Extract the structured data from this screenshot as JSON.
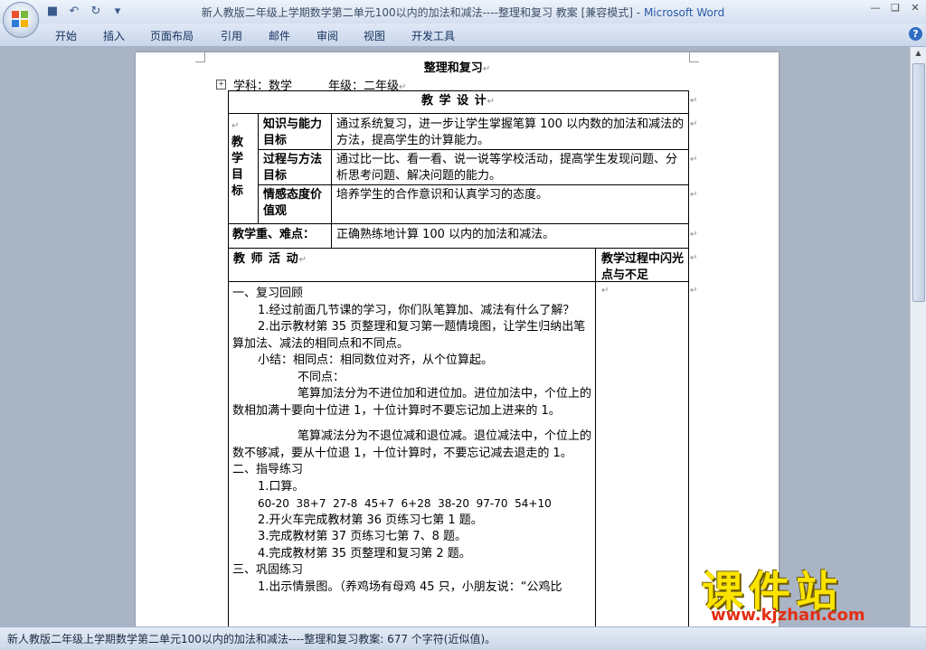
{
  "window": {
    "title": "新人教版二年级上学期数学第二单元100以内的加法和减法----整理和复习 教案 [兼容模式]",
    "app_name": "Microsoft Word",
    "title_sep": " - "
  },
  "ribbon": {
    "tabs": [
      "开始",
      "插入",
      "页面布局",
      "引用",
      "邮件",
      "审阅",
      "视图",
      "开发工具"
    ]
  },
  "document": {
    "heading": "整理和复习",
    "subject": "学科：数学",
    "grade": "年级：二年级",
    "table_title": "教 学 设 计",
    "goal_label_chars": [
      "教",
      "学",
      "目",
      "标"
    ],
    "goals": [
      {
        "label": "知识与能力目标",
        "text": "通过系统复习，进一步让学生掌握笔算 100 以内数的加法和减法的方法，提高学生的计算能力。"
      },
      {
        "label": "过程与方法目标",
        "text": "通过比一比、看一看、说一说等学校活动，提高学生发现问题、分析思考问题、解决问题的能力。"
      },
      {
        "label": "情感态度价值观",
        "text": "培养学生的合作意识和认真学习的态度。"
      }
    ],
    "key_label": "教学重、难点：",
    "key_text": "正确熟练地计算 100 以内的加法和减法。",
    "activity_header": "教 师 活 动",
    "reflect_header": "教学过程中闪光点与不足",
    "body": [
      "一、复习回顾",
      "1.经过前面几节课的学习，你们队笔算加、减法有什么了解？",
      "2.出示教材第 35 页整理和复习第一题情境图，让学生归纳出笔算加法、减法的相同点和不同点。",
      "小结：相同点：相同数位对齐，从个位算起。",
      "不同点：",
      "笔算加法分为不进位加和进位加。进位加法中，个位上的数相加满十要向十位进 1，十位计算时不要忘记加上进来的 1。",
      "笔算减法分为不退位减和退位减。退位减法中，个位上的数不够减，要从十位退 1，十位计算时，不要忘记减去退走的 1。",
      "二、指导练习",
      "1.口算。",
      "60-20  38+7  27-8  45+7  6+28  38-20  97-70  54+10",
      "2.开火车完成教材第 36 页练习七第 1 题。",
      "3.完成教材第 37 页练习七第 7、8 题。",
      "4.完成教材第 35 页整理和复习第 2 题。",
      "三、巩固练习",
      "1.出示情景图。（养鸡场有母鸡 45 只，小朋友说：“公鸡比"
    ]
  },
  "statusbar": {
    "text": "新人教版二年级上学期数学第二单元100以内的加法和减法----整理和复习教案: 677 个字符(近似值)。"
  },
  "watermark": {
    "brand": "课件站",
    "url": "www.kjzhan.com"
  },
  "colors": {
    "app_name": "#2a5aa8",
    "watermark_yellow": "#fce400",
    "watermark_red": "#e32e12"
  }
}
